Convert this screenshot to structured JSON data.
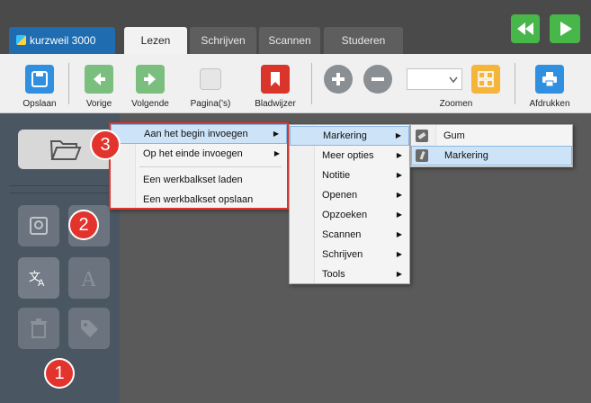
{
  "app": {
    "logo_text": "kurzweil 3000"
  },
  "tabs": [
    {
      "label": "Lezen",
      "active": true
    },
    {
      "label": "Schrijven"
    },
    {
      "label": "Scannen"
    },
    {
      "label": "Studeren"
    }
  ],
  "media_controls": [
    {
      "icon": "rewind-icon"
    },
    {
      "icon": "play-icon"
    }
  ],
  "toolbar": {
    "save": "Opslaan",
    "prev": "Vorige",
    "next": "Volgende",
    "pages": "Pagina('s)",
    "bookmark": "Bladwijzer",
    "zoom": "Zoomen",
    "print": "Afdrukken"
  },
  "menu1": {
    "items": [
      {
        "label": "Aan het begin invoegen",
        "submenu": true,
        "highlighted": true
      },
      {
        "label": "Op het einde invoegen",
        "submenu": true
      },
      {
        "label": "Een werkbalkset laden"
      },
      {
        "label": "Een werkbalkset opslaan"
      }
    ]
  },
  "menu2": {
    "items": [
      {
        "label": "Markering",
        "highlighted": true
      },
      {
        "label": "Meer opties"
      },
      {
        "label": "Notitie"
      },
      {
        "label": "Openen"
      },
      {
        "label": "Opzoeken"
      },
      {
        "label": "Scannen"
      },
      {
        "label": "Schrijven"
      },
      {
        "label": "Tools"
      }
    ]
  },
  "menu3": {
    "items": [
      {
        "label": "Gum",
        "icon": "eraser-icon"
      },
      {
        "label": "Markering",
        "icon": "highlighter-icon",
        "highlighted": true
      }
    ]
  },
  "badges": {
    "b1": "1",
    "b2": "2",
    "b3": "3"
  },
  "colors": {
    "accent_blue": "#1f6db0",
    "badge_red": "#e2342d",
    "menu_highlight": "#cde3f7",
    "sidebar": "#4b5663"
  }
}
